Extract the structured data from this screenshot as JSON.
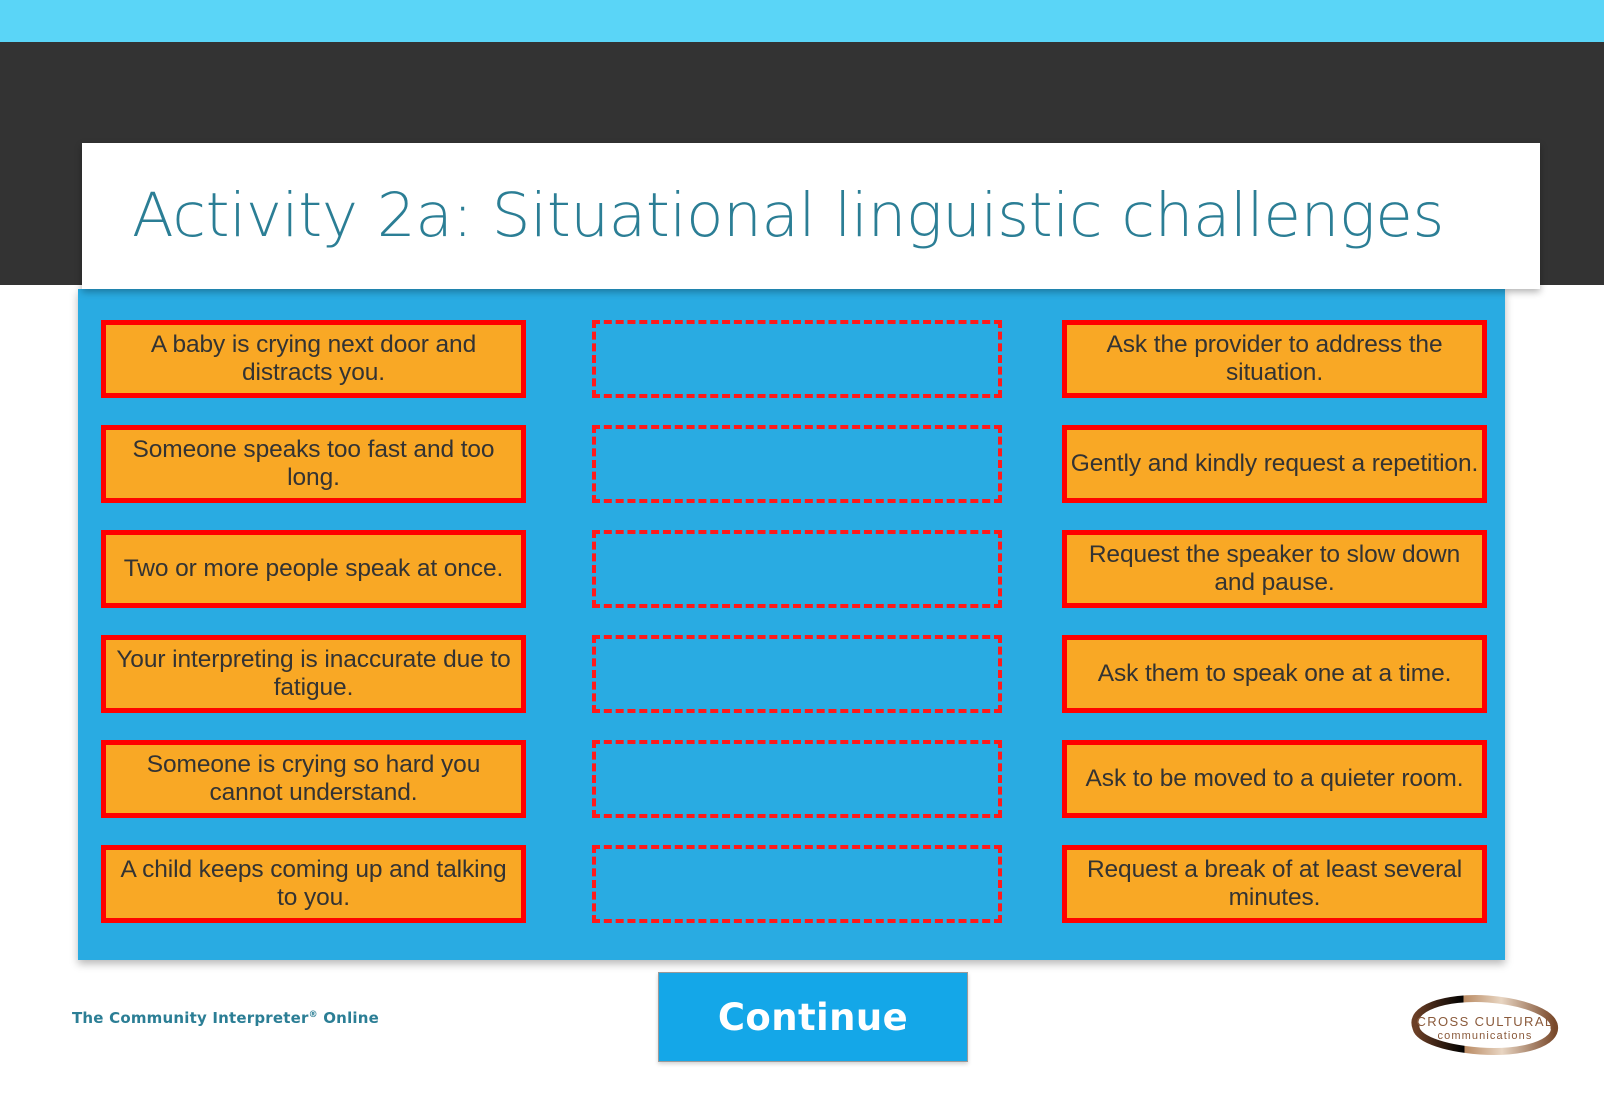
{
  "slide": {
    "title": "Activity 2a: Situational linguistic challenges"
  },
  "colors": {
    "top_strip": "#5ad5f7",
    "dark_band": "#333333",
    "panel_blue": "#29abe2",
    "card_orange": "#f9a825",
    "card_border_red": "#ff0000",
    "title_teal": "#2b7e95",
    "button_blue": "#14a7e8",
    "logo_bronze": "#8a5a3b"
  },
  "activity": {
    "challenges": [
      {
        "label": "A baby is crying next door and distracts you."
      },
      {
        "label": "Someone speaks too fast and too long."
      },
      {
        "label": "Two or more people speak at once."
      },
      {
        "label": "Your interpreting is inaccurate due to fatigue."
      },
      {
        "label": "Someone is crying so hard you cannot understand."
      },
      {
        "label": "A child keeps coming up and talking to you."
      }
    ],
    "dropzones": [
      {
        "label": ""
      },
      {
        "label": ""
      },
      {
        "label": ""
      },
      {
        "label": ""
      },
      {
        "label": ""
      },
      {
        "label": ""
      }
    ],
    "strategies": [
      {
        "label": "Ask the provider to address the situation."
      },
      {
        "label": "Gently and kindly request a repetition."
      },
      {
        "label": "Request the speaker to slow down and pause."
      },
      {
        "label": "Ask them to speak one at a time."
      },
      {
        "label": "Ask to be moved to a quieter room."
      },
      {
        "label": "Request a break of at least several minutes."
      }
    ]
  },
  "footer": {
    "brand_prefix": "The Community Interpreter",
    "brand_mark": "®",
    "brand_suffix": " Online",
    "continue_label": "Continue",
    "logo_line1": "CROSS CULTURAL",
    "logo_line2": "communications"
  }
}
